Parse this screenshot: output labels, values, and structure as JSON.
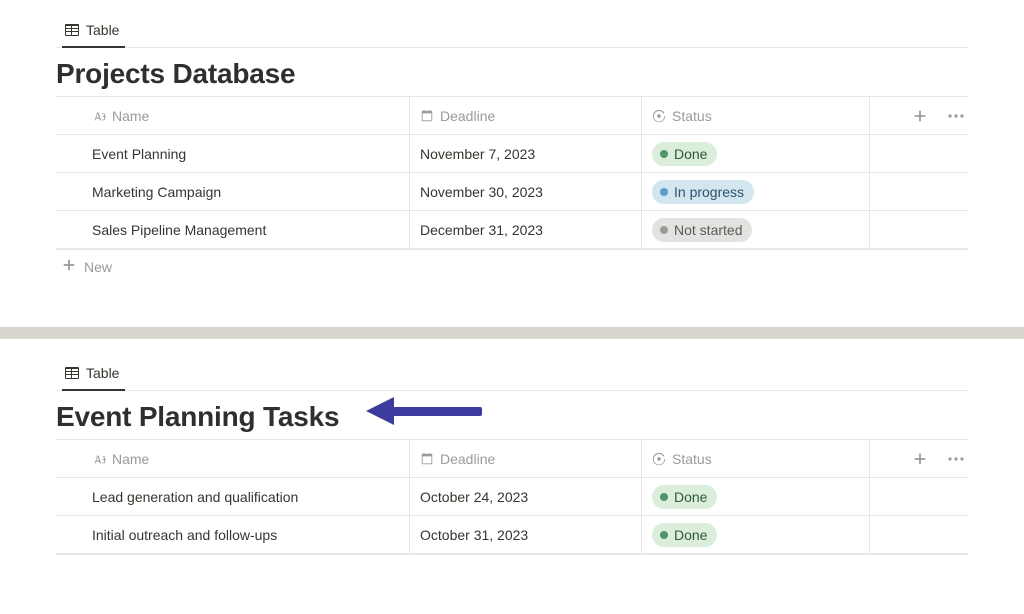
{
  "databases": [
    {
      "view_tab_label": "Table",
      "title": "Projects Database",
      "columns": {
        "name": "Name",
        "deadline": "Deadline",
        "status": "Status"
      },
      "new_label": "New",
      "rows": [
        {
          "name": "Event Planning",
          "deadline": "November 7, 2023",
          "status_label": "Done",
          "status_kind": "done"
        },
        {
          "name": "Marketing Campaign",
          "deadline": "November 30, 2023",
          "status_label": "In progress",
          "status_kind": "progress"
        },
        {
          "name": "Sales Pipeline Management",
          "deadline": "December 31, 2023",
          "status_label": "Not started",
          "status_kind": "notstarted"
        }
      ]
    },
    {
      "view_tab_label": "Table",
      "title": "Event Planning Tasks",
      "columns": {
        "name": "Name",
        "deadline": "Deadline",
        "status": "Status"
      },
      "rows": [
        {
          "name": "Lead generation and qualification",
          "deadline": "October 24, 2023",
          "status_label": "Done",
          "status_kind": "done"
        },
        {
          "name": "Initial outreach and follow-ups",
          "deadline": "October 31, 2023",
          "status_label": "Done",
          "status_kind": "done"
        }
      ]
    }
  ],
  "status_colors": {
    "done": "#dbeddb",
    "progress": "#d3e5ef",
    "notstarted": "#e3e2e0"
  },
  "annotation_arrow_color": "#3d3b9e"
}
